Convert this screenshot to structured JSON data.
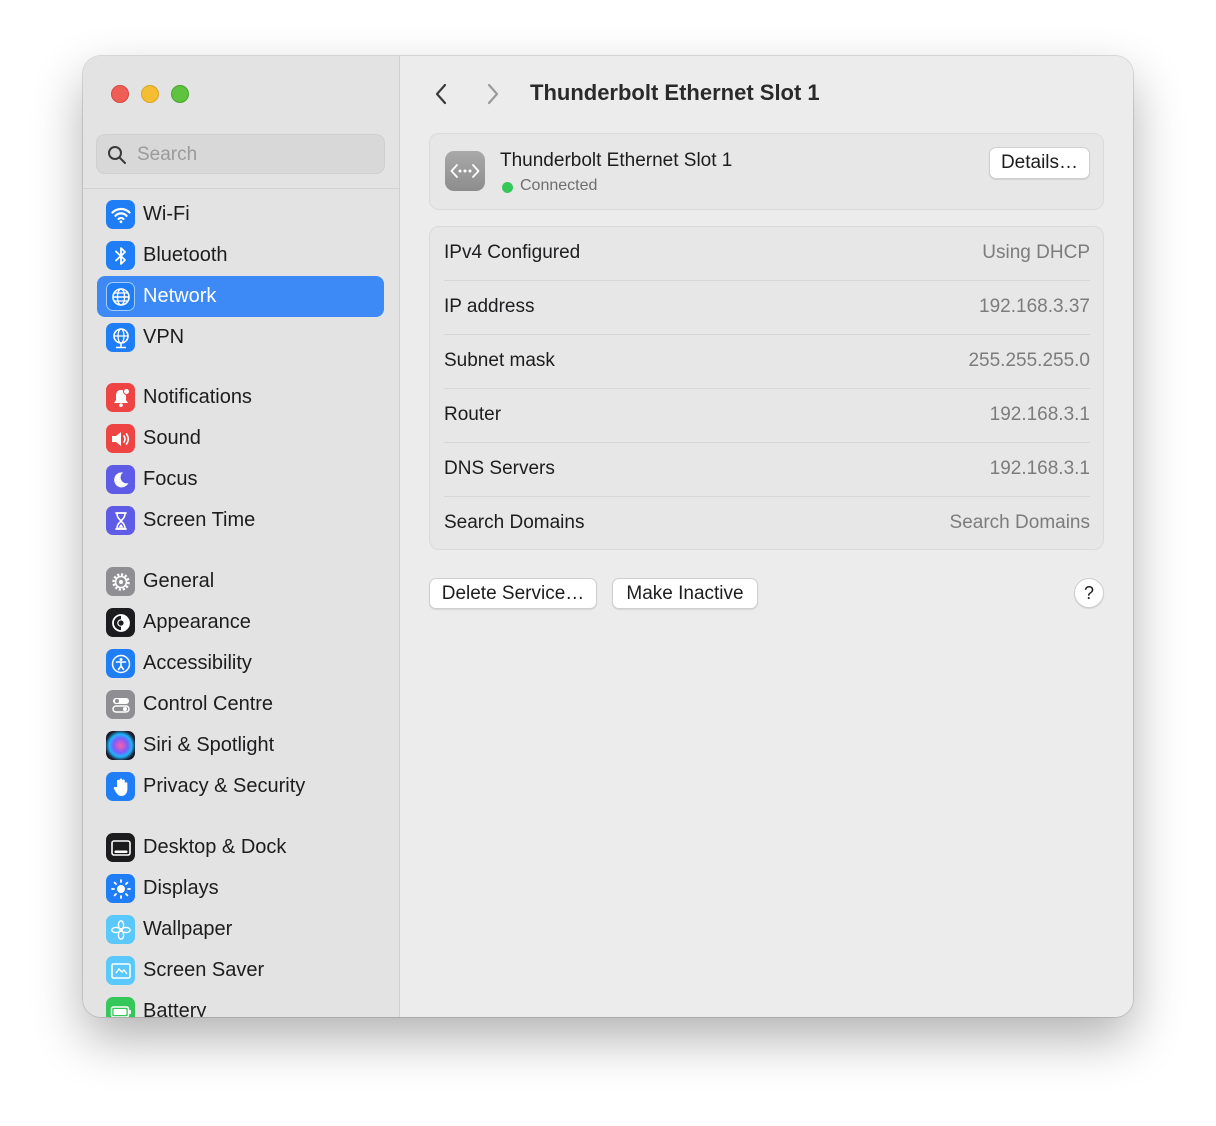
{
  "sidebar": {
    "search_placeholder": "Search",
    "items": [
      {
        "label": "Wi-Fi",
        "icon": "wifi-icon",
        "color": "#1f7df6"
      },
      {
        "label": "Bluetooth",
        "icon": "bluetooth-icon",
        "color": "#1f7df6"
      },
      {
        "label": "Network",
        "icon": "globe-icon",
        "color": "#1f7df6"
      },
      {
        "label": "VPN",
        "icon": "vpn-globe-icon",
        "color": "#1f7df6"
      },
      {
        "label": "Notifications",
        "icon": "bell-icon",
        "color": "#ee4444"
      },
      {
        "label": "Sound",
        "icon": "speaker-icon",
        "color": "#ee4444"
      },
      {
        "label": "Focus",
        "icon": "moon-icon",
        "color": "#5e5ce6"
      },
      {
        "label": "Screen Time",
        "icon": "hourglass-icon",
        "color": "#5e5ce6"
      },
      {
        "label": "General",
        "icon": "gear-icon",
        "color": "#8e8e93"
      },
      {
        "label": "Appearance",
        "icon": "appearance-icon",
        "color": "#1c1c1e"
      },
      {
        "label": "Accessibility",
        "icon": "accessibility-icon",
        "color": "#1f7df6"
      },
      {
        "label": "Control Centre",
        "icon": "control-centre-icon",
        "color": "#8e8e93"
      },
      {
        "label": "Siri & Spotlight",
        "icon": "siri-icon",
        "color": "#2b2b3a"
      },
      {
        "label": "Privacy & Security",
        "icon": "hand-icon",
        "color": "#1f7df6"
      },
      {
        "label": "Desktop & Dock",
        "icon": "dock-icon",
        "color": "#1c1c1e"
      },
      {
        "label": "Displays",
        "icon": "sun-icon",
        "color": "#1f7df6"
      },
      {
        "label": "Wallpaper",
        "icon": "flower-icon",
        "color": "#5ac8fa"
      },
      {
        "label": "Screen Saver",
        "icon": "screen-saver-icon",
        "color": "#5ac8fa"
      },
      {
        "label": "Battery",
        "icon": "battery-icon",
        "color": "#34c759"
      }
    ]
  },
  "header": {
    "title": "Thunderbolt Ethernet Slot 1"
  },
  "connection": {
    "name": "Thunderbolt Ethernet Slot 1",
    "status": "Connected",
    "status_color": "#35c759",
    "details_label": "Details…"
  },
  "details": [
    {
      "key": "IPv4 Configured",
      "value": "Using DHCP"
    },
    {
      "key": "IP address",
      "value": "192.168.3.37"
    },
    {
      "key": "Subnet mask",
      "value": "255.255.255.0"
    },
    {
      "key": "Router",
      "value": "192.168.3.1"
    },
    {
      "key": "DNS Servers",
      "value": "192.168.3.1"
    },
    {
      "key": "Search Domains",
      "value": "Search Domains"
    }
  ],
  "actions": {
    "delete_label": "Delete Service…",
    "inactive_label": "Make Inactive",
    "help_label": "?"
  },
  "colors": {
    "accent": "#3d8af7"
  }
}
